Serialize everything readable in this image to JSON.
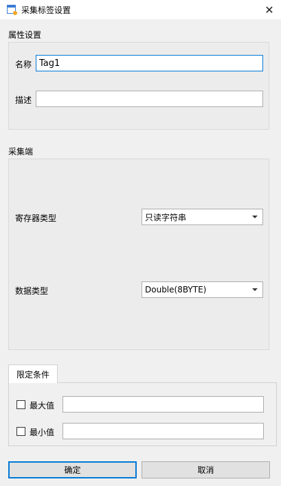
{
  "window": {
    "title": "采集标签设置",
    "close_glyph": "✕"
  },
  "properties": {
    "section_label": "属性设置",
    "name_label": "名称",
    "name_value": "Tag1",
    "description_label": "描述",
    "description_value": ""
  },
  "collector": {
    "section_label": "采集端",
    "register_type_label": "寄存器类型",
    "register_type_value": "只读字符串",
    "data_type_label": "数据类型",
    "data_type_value": "Double(8BYTE)"
  },
  "limits": {
    "tab_label": "限定条件",
    "max_label": "最大值",
    "max_checked": false,
    "max_value": "",
    "min_label": "最小值",
    "min_checked": false,
    "min_value": ""
  },
  "buttons": {
    "ok_label": "确定",
    "cancel_label": "取消"
  },
  "colors": {
    "focus_border": "#0078d7",
    "window_bg": "#f0f0f0"
  }
}
